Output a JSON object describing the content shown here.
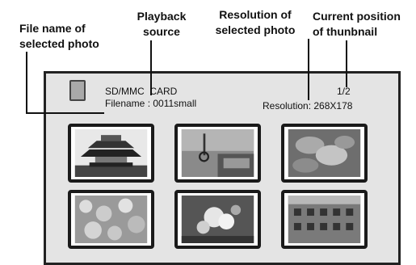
{
  "callouts": {
    "file_name": [
      "File name of",
      "selected photo"
    ],
    "playback_source": [
      "Playback",
      "source"
    ],
    "resolution": [
      "Resolution of",
      "selected photo"
    ],
    "position": [
      "Current position",
      "of thunbnail"
    ]
  },
  "screen": {
    "card_icon": "sd-card-icon",
    "source_label": "SD/MMC  CARD",
    "filename_label": "Filename : 0011small",
    "position_label": "1/2",
    "resolution_label": "Resolution: 268X178"
  },
  "thumbnails": [
    {
      "subject": "pagoda-temple"
    },
    {
      "subject": "bus-interior"
    },
    {
      "subject": "leaves"
    },
    {
      "subject": "flowers-tree"
    },
    {
      "subject": "blossoms"
    },
    {
      "subject": "building-facade"
    }
  ]
}
